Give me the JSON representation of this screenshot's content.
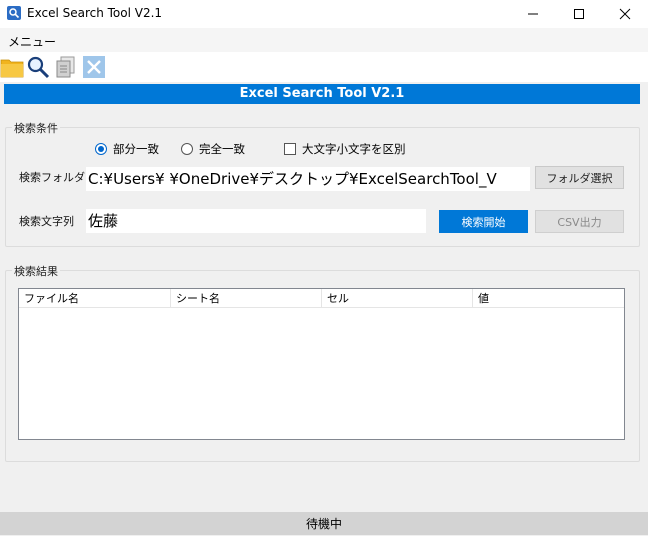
{
  "window": {
    "title": "Excel Search Tool V2.1",
    "icon": "magnifier-app-icon"
  },
  "menu": {
    "items": [
      "メニュー"
    ]
  },
  "toolbar": {
    "icons": [
      "folder-icon",
      "search-icon",
      "copy-icon",
      "clear-icon"
    ]
  },
  "banner": {
    "text": "Excel Search Tool V2.1",
    "color": "#0078d7"
  },
  "search_conditions": {
    "caption": "検索条件",
    "match_mode": {
      "options": [
        "部分一致",
        "完全一致"
      ],
      "selected": "部分一致"
    },
    "case_sensitive": {
      "label": "大文字小文字を区別",
      "checked": false
    },
    "folder": {
      "label": "検索フォルダ",
      "value": "C:¥Users¥        ¥OneDrive¥デスクトップ¥ExcelSearchTool_V",
      "button": "フォルダ選択"
    },
    "search_text": {
      "label": "検索文字列",
      "value": "佐藤",
      "search_button": "検索開始",
      "csv_button": "CSV出力"
    }
  },
  "results": {
    "caption": "検索結果",
    "columns": [
      "ファイル名",
      "シート名",
      "セル",
      "値"
    ],
    "rows": []
  },
  "status": {
    "text": "待機中"
  },
  "colors": {
    "accent": "#0078d7",
    "status_bg": "#d3d3d3"
  }
}
